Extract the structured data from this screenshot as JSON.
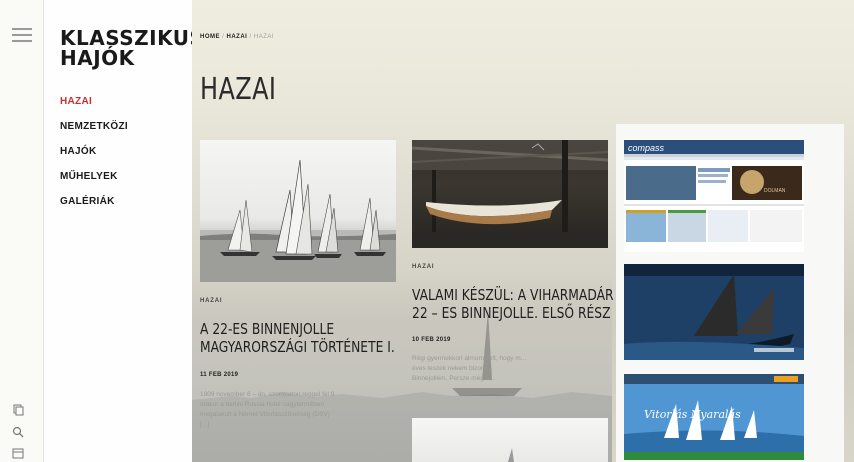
{
  "rail": {
    "icons": [
      "menu-icon",
      "copy-icon",
      "search-icon",
      "calendar-icon"
    ]
  },
  "site": {
    "logo": "KLASSZIKUS\nHAJÓK"
  },
  "menu": [
    {
      "label": "HAZAI",
      "active": true
    },
    {
      "label": "NEMZETKÖZI",
      "active": false
    },
    {
      "label": "HAJÓK",
      "active": false
    },
    {
      "label": "MŰHELYEK",
      "active": false
    },
    {
      "label": "GALÉRIÁK",
      "active": false
    }
  ],
  "breadcrumb": {
    "home": "HOME",
    "sep": "/",
    "middle": "HAZAI",
    "current": "HAZAI"
  },
  "page": {
    "title": "HAZAI"
  },
  "posts": [
    {
      "category": "HAZAI",
      "title_line1": "A 22-ES BINNENJOLLE",
      "title_line2": "MAGYARORSZÁGI TÖRTÉNETE I.",
      "date": "11 FEB 2019",
      "excerpt_lines": [
        "1909 november 6 – án, szombaton reggel fél 9",
        "órakor a berlini Russia hotel nagytermében",
        "megalakult a Német Vitorlásszövetség (DSV)",
        "[...]"
      ]
    },
    {
      "category": "HAZAI",
      "title_line1": "VALAMI KÉSZÜL: A VIHARMADÁR",
      "title_line2": "22 – ES BINNEJOLLE. ELSŐ RÉSZ",
      "date": "10 FEB 2019",
      "excerpt_lines": [
        "Régi gyermekkori álmom volt, hogy m...",
        "éves leszek nekem bizony...",
        "Binnejollém. Persze még s..."
      ]
    }
  ],
  "ads": {
    "compass_logo": "compass",
    "hajokonyv_logo": "DOLMAN",
    "banner_caption": "Vitorlás Nyaralás"
  },
  "colors": {
    "accent": "#c8312f",
    "text": "#1f1f1f",
    "muted": "#a0a0a0"
  }
}
